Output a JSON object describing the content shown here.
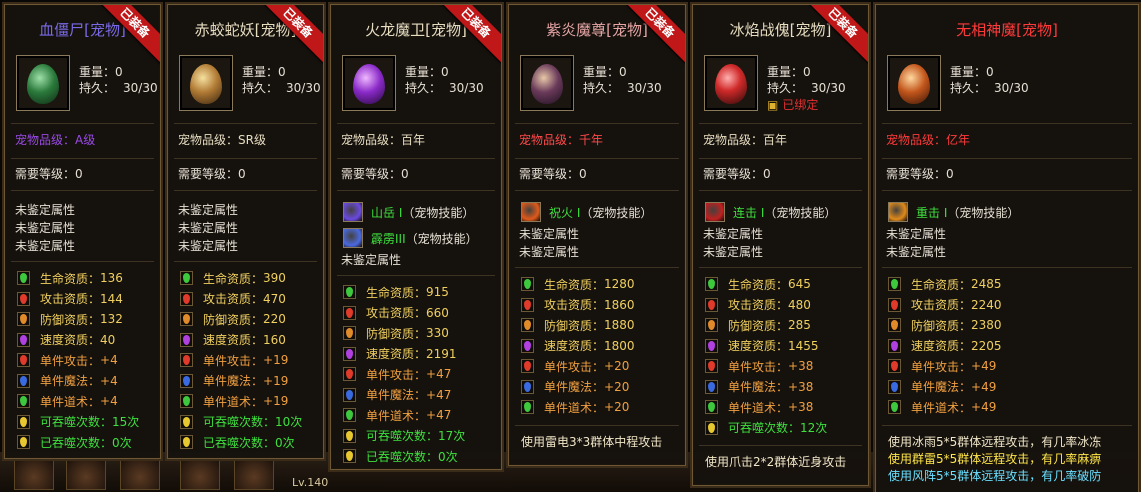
{
  "labels": {
    "weight": "重量：",
    "durability": "持久：",
    "bound": "已绑定",
    "req_level": "需要等级：",
    "unident": "未鉴定属性",
    "skill_tag": "（宠物技能）",
    "ribbon": "已装备"
  },
  "stat_names": {
    "hp": "生命资质：",
    "atk": "攻击资质：",
    "def": "防御资质：",
    "spd": "速度资质：",
    "s_atk": "单件攻击：",
    "s_mag": "单件魔法：",
    "s_tao": "单件道术：",
    "swallow": "可吞噬次数：",
    "swallowed": "已吞噬次数："
  },
  "gem_colors": {
    "hp": "#3ec83e",
    "atk": "#e03a2a",
    "def": "#e08a2a",
    "spd": "#b040e0",
    "s_atk": "#e03a2a",
    "s_mag": "#3a6ae0",
    "s_tao": "#3ec83e",
    "swallow": "#e8c830",
    "swallowed": "#e8c830"
  },
  "cards": [
    {
      "title": "血僵尸[宠物]",
      "title_color": "#7a6ae6",
      "ribbon": true,
      "egg": "egg-green",
      "weight": "0",
      "durability": "30/30",
      "bound": false,
      "grade": "宠物品级：A级",
      "grade_color": "#9a4ae6",
      "req_level": "0",
      "skills": [],
      "unident_count": 3,
      "stats": [
        {
          "k": "hp",
          "v": "136"
        },
        {
          "k": "atk",
          "v": "144"
        },
        {
          "k": "def",
          "v": "132"
        },
        {
          "k": "spd",
          "v": "40"
        },
        {
          "k": "s_atk",
          "v": "+4"
        },
        {
          "k": "s_mag",
          "v": "+4"
        },
        {
          "k": "s_tao",
          "v": "+4"
        },
        {
          "k": "swallow",
          "v": "15次"
        },
        {
          "k": "swallowed",
          "v": "0次"
        }
      ],
      "footer": []
    },
    {
      "title": "赤蛟蛇妖[宠物]",
      "title_color": "#e6dcc0",
      "ribbon": true,
      "egg": "egg-amber",
      "weight": "0",
      "durability": "30/30",
      "bound": false,
      "grade": "宠物品级：SR级",
      "grade_color": "#e6dcc0",
      "req_level": "0",
      "skills": [],
      "unident_count": 3,
      "stats": [
        {
          "k": "hp",
          "v": "390"
        },
        {
          "k": "atk",
          "v": "470"
        },
        {
          "k": "def",
          "v": "220"
        },
        {
          "k": "spd",
          "v": "160"
        },
        {
          "k": "s_atk",
          "v": "+19"
        },
        {
          "k": "s_mag",
          "v": "+19"
        },
        {
          "k": "s_tao",
          "v": "+19"
        },
        {
          "k": "swallow",
          "v": "10次"
        },
        {
          "k": "swallowed",
          "v": "0次"
        }
      ],
      "footer": []
    },
    {
      "title": "火龙魔卫[宠物]",
      "title_color": "#e6dcc0",
      "ribbon": true,
      "egg": "egg-purple",
      "weight": "0",
      "durability": "30/30",
      "bound": false,
      "grade": "宠物品级：百年",
      "grade_color": "#e6dcc0",
      "req_level": "0",
      "skills": [
        {
          "name": "山岳 I",
          "color": "#3ee03e",
          "icon_color": "#6a4ae0"
        },
        {
          "name": "霹雳III",
          "color": "#3ee03e",
          "icon_color": "#4a6ae0"
        }
      ],
      "unident_count": 1,
      "stats": [
        {
          "k": "hp",
          "v": "915"
        },
        {
          "k": "atk",
          "v": "660"
        },
        {
          "k": "def",
          "v": "330"
        },
        {
          "k": "spd",
          "v": "2191"
        },
        {
          "k": "s_atk",
          "v": "+47"
        },
        {
          "k": "s_mag",
          "v": "+47"
        },
        {
          "k": "s_tao",
          "v": "+47"
        },
        {
          "k": "swallow",
          "v": "17次"
        },
        {
          "k": "swallowed",
          "v": "0次"
        }
      ],
      "footer": []
    },
    {
      "title": "紫炎魔尊[宠物]",
      "title_color": "#e6a6a6",
      "ribbon": true,
      "egg": "egg-bronze",
      "weight": "0",
      "durability": "30/30",
      "bound": false,
      "grade": "宠物品级：千年",
      "grade_color": "#ff4a4a",
      "req_level": "0",
      "skills": [
        {
          "name": "祝火 I",
          "color": "#3ee03e",
          "icon_color": "#e05a1a"
        }
      ],
      "unident_count": 2,
      "stats": [
        {
          "k": "hp",
          "v": "1280"
        },
        {
          "k": "atk",
          "v": "1860"
        },
        {
          "k": "def",
          "v": "1880"
        },
        {
          "k": "spd",
          "v": "1800"
        },
        {
          "k": "s_atk",
          "v": "+20"
        },
        {
          "k": "s_mag",
          "v": "+20"
        },
        {
          "k": "s_tao",
          "v": "+20"
        }
      ],
      "footer": [
        {
          "text": "使用雷电3*3群体中程攻击",
          "color": "#f0e6c8"
        }
      ]
    },
    {
      "title": "冰焰战傀[宠物]",
      "title_color": "#e6dcc0",
      "ribbon": true,
      "egg": "egg-red",
      "weight": "0",
      "durability": "30/30",
      "bound": true,
      "grade": "宠物品级：百年",
      "grade_color": "#e6dcc0",
      "req_level": "0",
      "skills": [
        {
          "name": "连击 I",
          "color": "#3ee03e",
          "icon_color": "#c02020"
        }
      ],
      "unident_count": 2,
      "stats": [
        {
          "k": "hp",
          "v": "645"
        },
        {
          "k": "atk",
          "v": "480"
        },
        {
          "k": "def",
          "v": "285"
        },
        {
          "k": "spd",
          "v": "1455"
        },
        {
          "k": "s_atk",
          "v": "+38"
        },
        {
          "k": "s_mag",
          "v": "+38"
        },
        {
          "k": "s_tao",
          "v": "+38"
        },
        {
          "k": "swallow",
          "v": "12次"
        }
      ],
      "footer": [
        {
          "text": "使用爪击2*2群体近身攻击",
          "color": "#f0e6c8"
        }
      ]
    },
    {
      "title": "无相神魔[宠物]",
      "title_color": "#ff3a3a",
      "ribbon": false,
      "egg": "egg-orange",
      "weight": "0",
      "durability": "30/30",
      "bound": false,
      "grade": "宠物品级：亿年",
      "grade_color": "#ff3a3a",
      "req_level": "0",
      "skills": [
        {
          "name": "重击 I",
          "color": "#3ee03e",
          "icon_color": "#e08a1a"
        }
      ],
      "unident_count": 2,
      "stats": [
        {
          "k": "hp",
          "v": "2485"
        },
        {
          "k": "atk",
          "v": "2240"
        },
        {
          "k": "def",
          "v": "2380"
        },
        {
          "k": "spd",
          "v": "2205"
        },
        {
          "k": "s_atk",
          "v": "+49"
        },
        {
          "k": "s_mag",
          "v": "+49"
        },
        {
          "k": "s_tao",
          "v": "+49"
        }
      ],
      "footer": [
        {
          "text": "使用冰雨5*5群体远程攻击，有几率冰冻",
          "color": "#f0e6c8"
        },
        {
          "text": "使用群雷5*5群体远程攻击，有几率麻痹",
          "color": "#ffe64a"
        },
        {
          "text": "使用风阵5*5群体远程攻击，有几率破防",
          "color": "#6ae0ff"
        }
      ]
    }
  ],
  "bottom_bar": {
    "level_text": "Lv.140"
  }
}
